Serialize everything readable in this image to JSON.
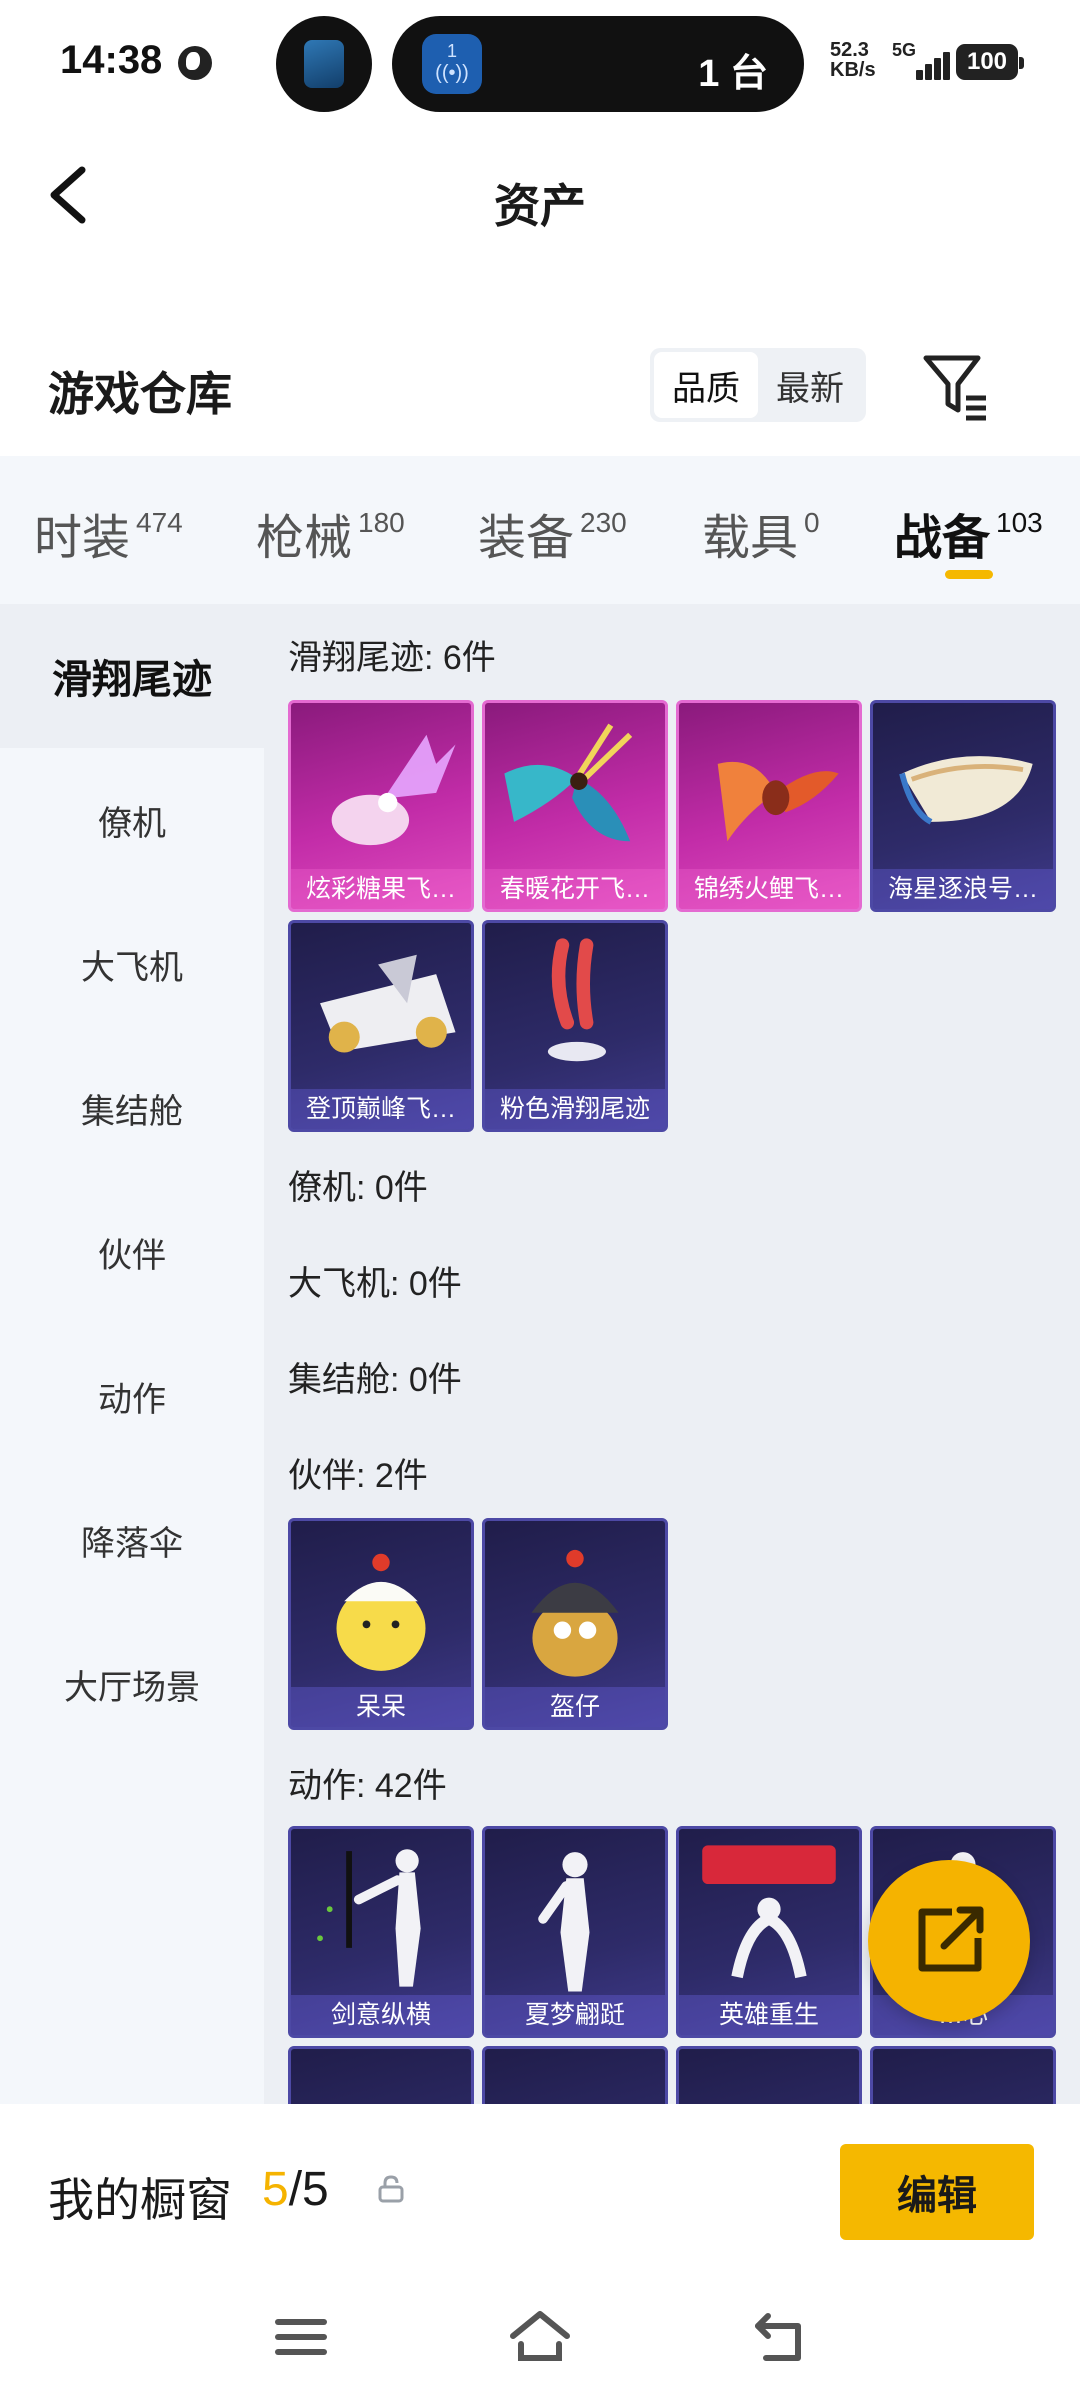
{
  "status_bar": {
    "time": "14:38",
    "cast_label": "1",
    "device_count": "1 台",
    "speed_value": "52.3",
    "speed_unit": "KB/s",
    "network": "5G",
    "battery": "100"
  },
  "header": {
    "title": "资产"
  },
  "warehouse": {
    "title": "游戏仓库",
    "sort_options": [
      "品质",
      "最新"
    ],
    "active_sort": "品质"
  },
  "category_tabs": [
    {
      "label": "时装",
      "count": "474"
    },
    {
      "label": "枪械",
      "count": "180"
    },
    {
      "label": "装备",
      "count": "230"
    },
    {
      "label": "载具",
      "count": "0"
    },
    {
      "label": "战备",
      "count": "103"
    }
  ],
  "active_category": "战备",
  "sidebar": {
    "items": [
      "滑翔尾迹",
      "僚机",
      "大飞机",
      "集结舱",
      "伙伴",
      "动作",
      "降落伞",
      "大厅场景"
    ],
    "active": "滑翔尾迹"
  },
  "sections": {
    "glide": {
      "title": "滑翔尾迹: 6件",
      "items": [
        {
          "name": "炫彩糖果飞…",
          "rarity": "pink"
        },
        {
          "name": "春暖花开飞…",
          "rarity": "pink"
        },
        {
          "name": "锦绣火鲤飞…",
          "rarity": "pink"
        },
        {
          "name": "海星逐浪号…",
          "rarity": "purple"
        },
        {
          "name": "登顶巅峰飞…",
          "rarity": "purple"
        },
        {
          "name": "粉色滑翔尾迹",
          "rarity": "purple"
        }
      ]
    },
    "wingman": {
      "title": "僚机: 0件"
    },
    "plane": {
      "title": "大飞机: 0件"
    },
    "pod": {
      "title": "集结舱: 0件"
    },
    "partner": {
      "title": "伙伴: 2件",
      "items": [
        {
          "name": "呆呆",
          "rarity": "purple"
        },
        {
          "name": "盔仔",
          "rarity": "purple"
        }
      ]
    },
    "emote": {
      "title": "动作: 42件",
      "items": [
        {
          "name": "剑意纵横",
          "rarity": "purple"
        },
        {
          "name": "夏梦翩跹",
          "rarity": "purple"
        },
        {
          "name": "英雄重生",
          "rarity": "purple"
        },
        {
          "name": "…心",
          "rarity": "purple"
        }
      ]
    }
  },
  "showcase": {
    "label": "我的橱窗",
    "current": "5",
    "separator": "/",
    "total": "5",
    "edit_label": "编辑"
  },
  "colors": {
    "accent": "#f5b800",
    "pink_tile": "#c22ca8",
    "purple_tile": "#2e2b69",
    "content_bg": "#eceff4",
    "sidebar_bg": "#f4f7fb"
  },
  "icons": {
    "back": "chevron-left-icon",
    "filter": "filter-icon",
    "share": "share-out-icon",
    "lock": "lock-icon",
    "nav_menu": "menu-icon",
    "nav_home": "home-icon",
    "nav_back": "back-icon"
  }
}
